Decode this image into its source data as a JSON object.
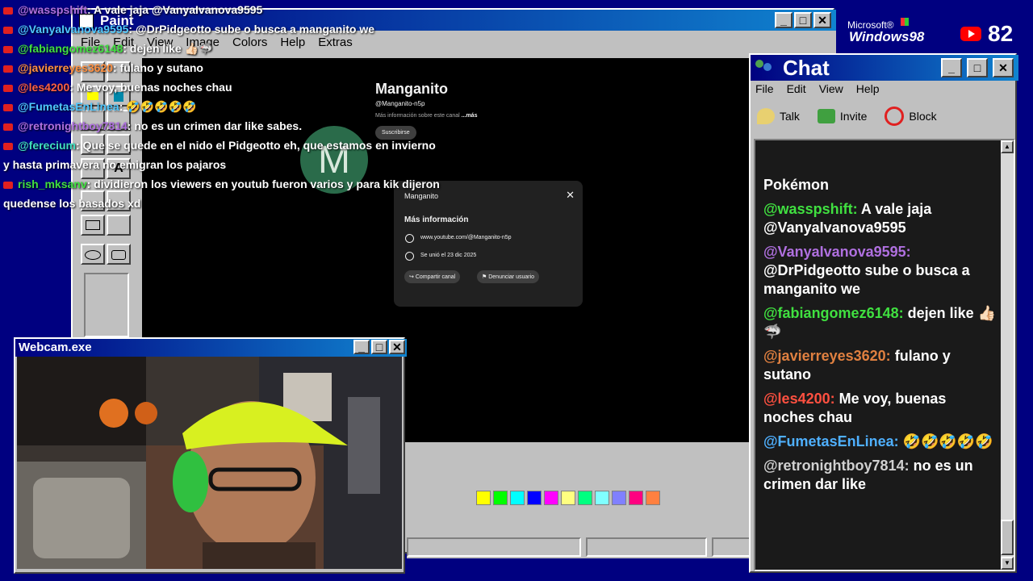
{
  "branding": {
    "ms_label": "Microsoft®",
    "win_label": "Windows98",
    "viewer_count": "82"
  },
  "paint": {
    "title": "Paint",
    "menus": [
      "File",
      "Edit",
      "View",
      "Image",
      "Colors",
      "Help",
      "Extras"
    ]
  },
  "youtube": {
    "avatar_letter": "M",
    "channel_name": "Manganito",
    "handle": "@Manganito-n5p",
    "description": "Más información sobre este canal",
    "more_link": "...más",
    "subscribe_label": "Suscribirse",
    "dialog": {
      "channel": "Manganito",
      "heading": "Más información",
      "url": "www.youtube.com/@Manganito-n5p",
      "joined": "Se unió el 23 dic 2025",
      "share_label": "Compartir canal",
      "report_label": "Denunciar usuario"
    }
  },
  "palette_colors": [
    "#ffff00",
    "#00ff00",
    "#00ffff",
    "#0000ff",
    "#ff00ff",
    "#ffff80",
    "#00ff80",
    "#80ffff",
    "#8080ff",
    "#ff0080",
    "#ff8040"
  ],
  "overlay_chat": [
    {
      "user": "@wasspshift",
      "text": ": A vale jaja @VanyaIvanova9595",
      "color": "#b070e0"
    },
    {
      "user": "@VanyaIvanova9595",
      "text": ": @DrPidgeotto sube o busca a manganito we",
      "color": "#4fc8ff"
    },
    {
      "user": "@fabiangomez6148",
      "text": ": dejen like 👍🏻🦈",
      "color": "#40e040"
    },
    {
      "user": "@javierreyes3620",
      "text": ": fulano y sutano",
      "color": "#ff9040"
    },
    {
      "user": "@les4200",
      "text": ": Me voy, buenas noches chau",
      "color": "#ff6040"
    },
    {
      "user": "@FumetasEnLinea",
      "text": ": 🤣🤣🤣🤣🤣",
      "color": "#4fc8ff"
    },
    {
      "user": "@retronightboy7814",
      "text": ": no es un crimen dar like sabes.",
      "color": "#b070e0"
    },
    {
      "user": "@ferecium",
      "text": ": Que se quede en el nido el Pidgeotto eh, que estamos en invierno",
      "color": "#40e0c0"
    },
    {
      "user": "",
      "text": "y hasta primavera no emigran los pajaros",
      "color": "#ffffff"
    },
    {
      "user": "rish_mksanv",
      "text": ": dividieron los viewers en youtub fueron varios y para kik dijeron",
      "color": "#40e040"
    },
    {
      "user": "",
      "text": "quedense los basados xd",
      "color": "#ffffff"
    }
  ],
  "webcam": {
    "title": "Webcam.exe"
  },
  "chat": {
    "title": "Chat",
    "menus": [
      "File",
      "Edit",
      "View",
      "Help"
    ],
    "talk_label": "Talk",
    "invite_label": "Invite",
    "block_label": "Block",
    "header_text": "Pokémon",
    "messages": [
      {
        "user": "@wasspshift:",
        "text": "A vale jaja @VanyaIvanova9595",
        "color": "#40e040"
      },
      {
        "user": "@VanyaIvanova9595:",
        "text": "@DrPidgeotto sube o busca a manganito we",
        "color": "#b070e0"
      },
      {
        "user": "@fabiangomez6148:",
        "text": "dejen like 👍🏻🦈",
        "color": "#40e040"
      },
      {
        "user": "@javierreyes3620:",
        "text": "fulano y sutano",
        "color": "#e08040"
      },
      {
        "user": "@les4200:",
        "text": "Me voy, buenas noches chau",
        "color": "#ff5040"
      },
      {
        "user": "@FumetasEnLinea:",
        "text": "🤣🤣🤣🤣🤣",
        "color": "#4fb0ff"
      },
      {
        "user": "@retronightboy7814:",
        "text": "no es un crimen dar like",
        "color": "#d0d0d0"
      }
    ]
  }
}
